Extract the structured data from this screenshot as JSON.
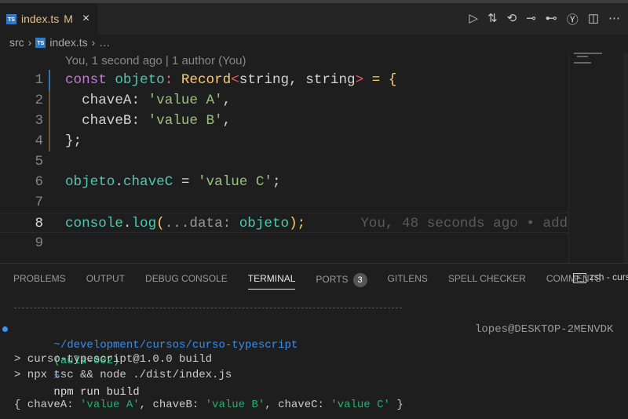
{
  "tab": {
    "icon": "typescript-file-icon",
    "name": "index.ts",
    "status": "M",
    "close": "×"
  },
  "actions": [
    "▷",
    "⇅",
    "⟲",
    "⊸",
    "⊷",
    "Ⓨ",
    "◫",
    "⋯"
  ],
  "breadcrumb": {
    "folder": "src",
    "file": "index.ts",
    "more": "…",
    "sep": "›"
  },
  "editor": {
    "blame_header": "You, 1 second ago | 1 author (You)",
    "lines": [
      {
        "n": "1",
        "tokens": [
          {
            "t": "const ",
            "c": "#c678dd"
          },
          {
            "t": "objeto",
            "c": "#4ec9b0"
          },
          {
            "t": ": ",
            "c": "#f07178"
          },
          {
            "t": "Record",
            "c": "#ffcb6b"
          },
          {
            "t": "<",
            "c": "#ff5370"
          },
          {
            "t": "string, string",
            "c": "#d4d4d4"
          },
          {
            "t": ">",
            "c": "#ff5370"
          },
          {
            "t": " = {",
            "c": "#ffcb6b"
          }
        ]
      },
      {
        "n": "2",
        "tokens": [
          {
            "t": "  chaveA: ",
            "c": "#d4d4d4"
          },
          {
            "t": "'value A'",
            "c": "#98c379"
          },
          {
            "t": ",",
            "c": "#d4d4d4"
          }
        ]
      },
      {
        "n": "3",
        "tokens": [
          {
            "t": "  chaveB: ",
            "c": "#d4d4d4"
          },
          {
            "t": "'value B'",
            "c": "#98c379"
          },
          {
            "t": ",",
            "c": "#d4d4d4"
          }
        ]
      },
      {
        "n": "4",
        "tokens": [
          {
            "t": "};",
            "c": "#d4d4d4"
          }
        ]
      },
      {
        "n": "5",
        "tokens": []
      },
      {
        "n": "6",
        "tokens": [
          {
            "t": "objeto",
            "c": "#4ec9b0"
          },
          {
            "t": ".",
            "c": "#d4d4d4"
          },
          {
            "t": "chaveC",
            "c": "#4ec9b0"
          },
          {
            "t": " = ",
            "c": "#d4d4d4"
          },
          {
            "t": "'value C'",
            "c": "#98c379"
          },
          {
            "t": ";",
            "c": "#d4d4d4"
          }
        ]
      },
      {
        "n": "7",
        "tokens": []
      },
      {
        "n": "8",
        "tokens": [
          {
            "t": "console",
            "c": "#4ec9b0"
          },
          {
            "t": ".",
            "c": "#d4d4d4"
          },
          {
            "t": "log",
            "c": "#4ec9b0"
          },
          {
            "t": "(",
            "c": "#ffcb6b"
          },
          {
            "t": "...data: ",
            "c": "#999999"
          },
          {
            "t": "objeto",
            "c": "#4ec9b0"
          },
          {
            "t": ");",
            "c": "#ffcb6b"
          }
        ],
        "blame": "You, 48 seconds ago • add"
      },
      {
        "n": "9",
        "tokens": []
      }
    ]
  },
  "panel": {
    "tabs": [
      {
        "label": "PROBLEMS"
      },
      {
        "label": "OUTPUT"
      },
      {
        "label": "DEBUG CONSOLE"
      },
      {
        "label": "TERMINAL",
        "active": true
      },
      {
        "label": "PORTS",
        "badge": "3"
      },
      {
        "label": "GITLENS"
      },
      {
        "label": "SPELL CHECKER"
      },
      {
        "label": "COMMENTS"
      }
    ],
    "shell": "zsh - curs"
  },
  "terminal": {
    "path": "~/development/cursos/curso-typescript",
    "branch": "(aula-002)",
    "prompt": "»",
    "command": "npm run build",
    "right": "lopes@DESKTOP-2MENVDK",
    "out1": "> curso-typescript@1.0.0 build",
    "out2": "> npx tsc && node ./dist/index.js",
    "result": [
      {
        "t": "{ chaveA: ",
        "c": "#cccccc"
      },
      {
        "t": "'value A'",
        "c": "#23b26d"
      },
      {
        "t": ", chaveB: ",
        "c": "#cccccc"
      },
      {
        "t": "'value B'",
        "c": "#23b26d"
      },
      {
        "t": ", chaveC: ",
        "c": "#cccccc"
      },
      {
        "t": "'value C'",
        "c": "#23b26d"
      },
      {
        "t": " }",
        "c": "#cccccc"
      }
    ]
  }
}
